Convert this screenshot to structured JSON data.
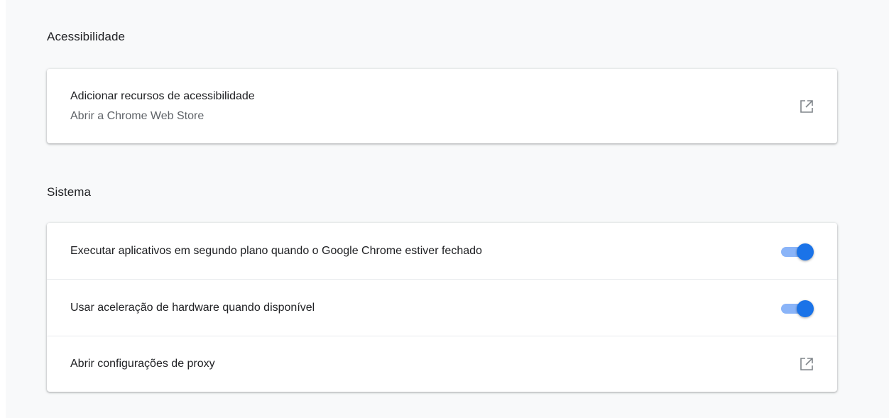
{
  "accessibility": {
    "title": "Acessibilidade",
    "add_features": {
      "label": "Adicionar recursos de acessibilidade",
      "sublabel": "Abrir a Chrome Web Store",
      "icon": "open-in-new-icon"
    }
  },
  "system": {
    "title": "Sistema",
    "background_apps": {
      "label": "Executar aplicativos em segundo plano quando o Google Chrome estiver fechado",
      "enabled": true
    },
    "hardware_acceleration": {
      "label": "Usar aceleração de hardware quando disponível",
      "enabled": true
    },
    "proxy": {
      "label": "Abrir configurações de proxy",
      "icon": "open-in-new-icon"
    }
  },
  "colors": {
    "toggle_on_knob": "#1a73e8",
    "toggle_on_track": "#8ab4f8",
    "page_background": "#f8f9fa",
    "card_background": "#ffffff"
  }
}
